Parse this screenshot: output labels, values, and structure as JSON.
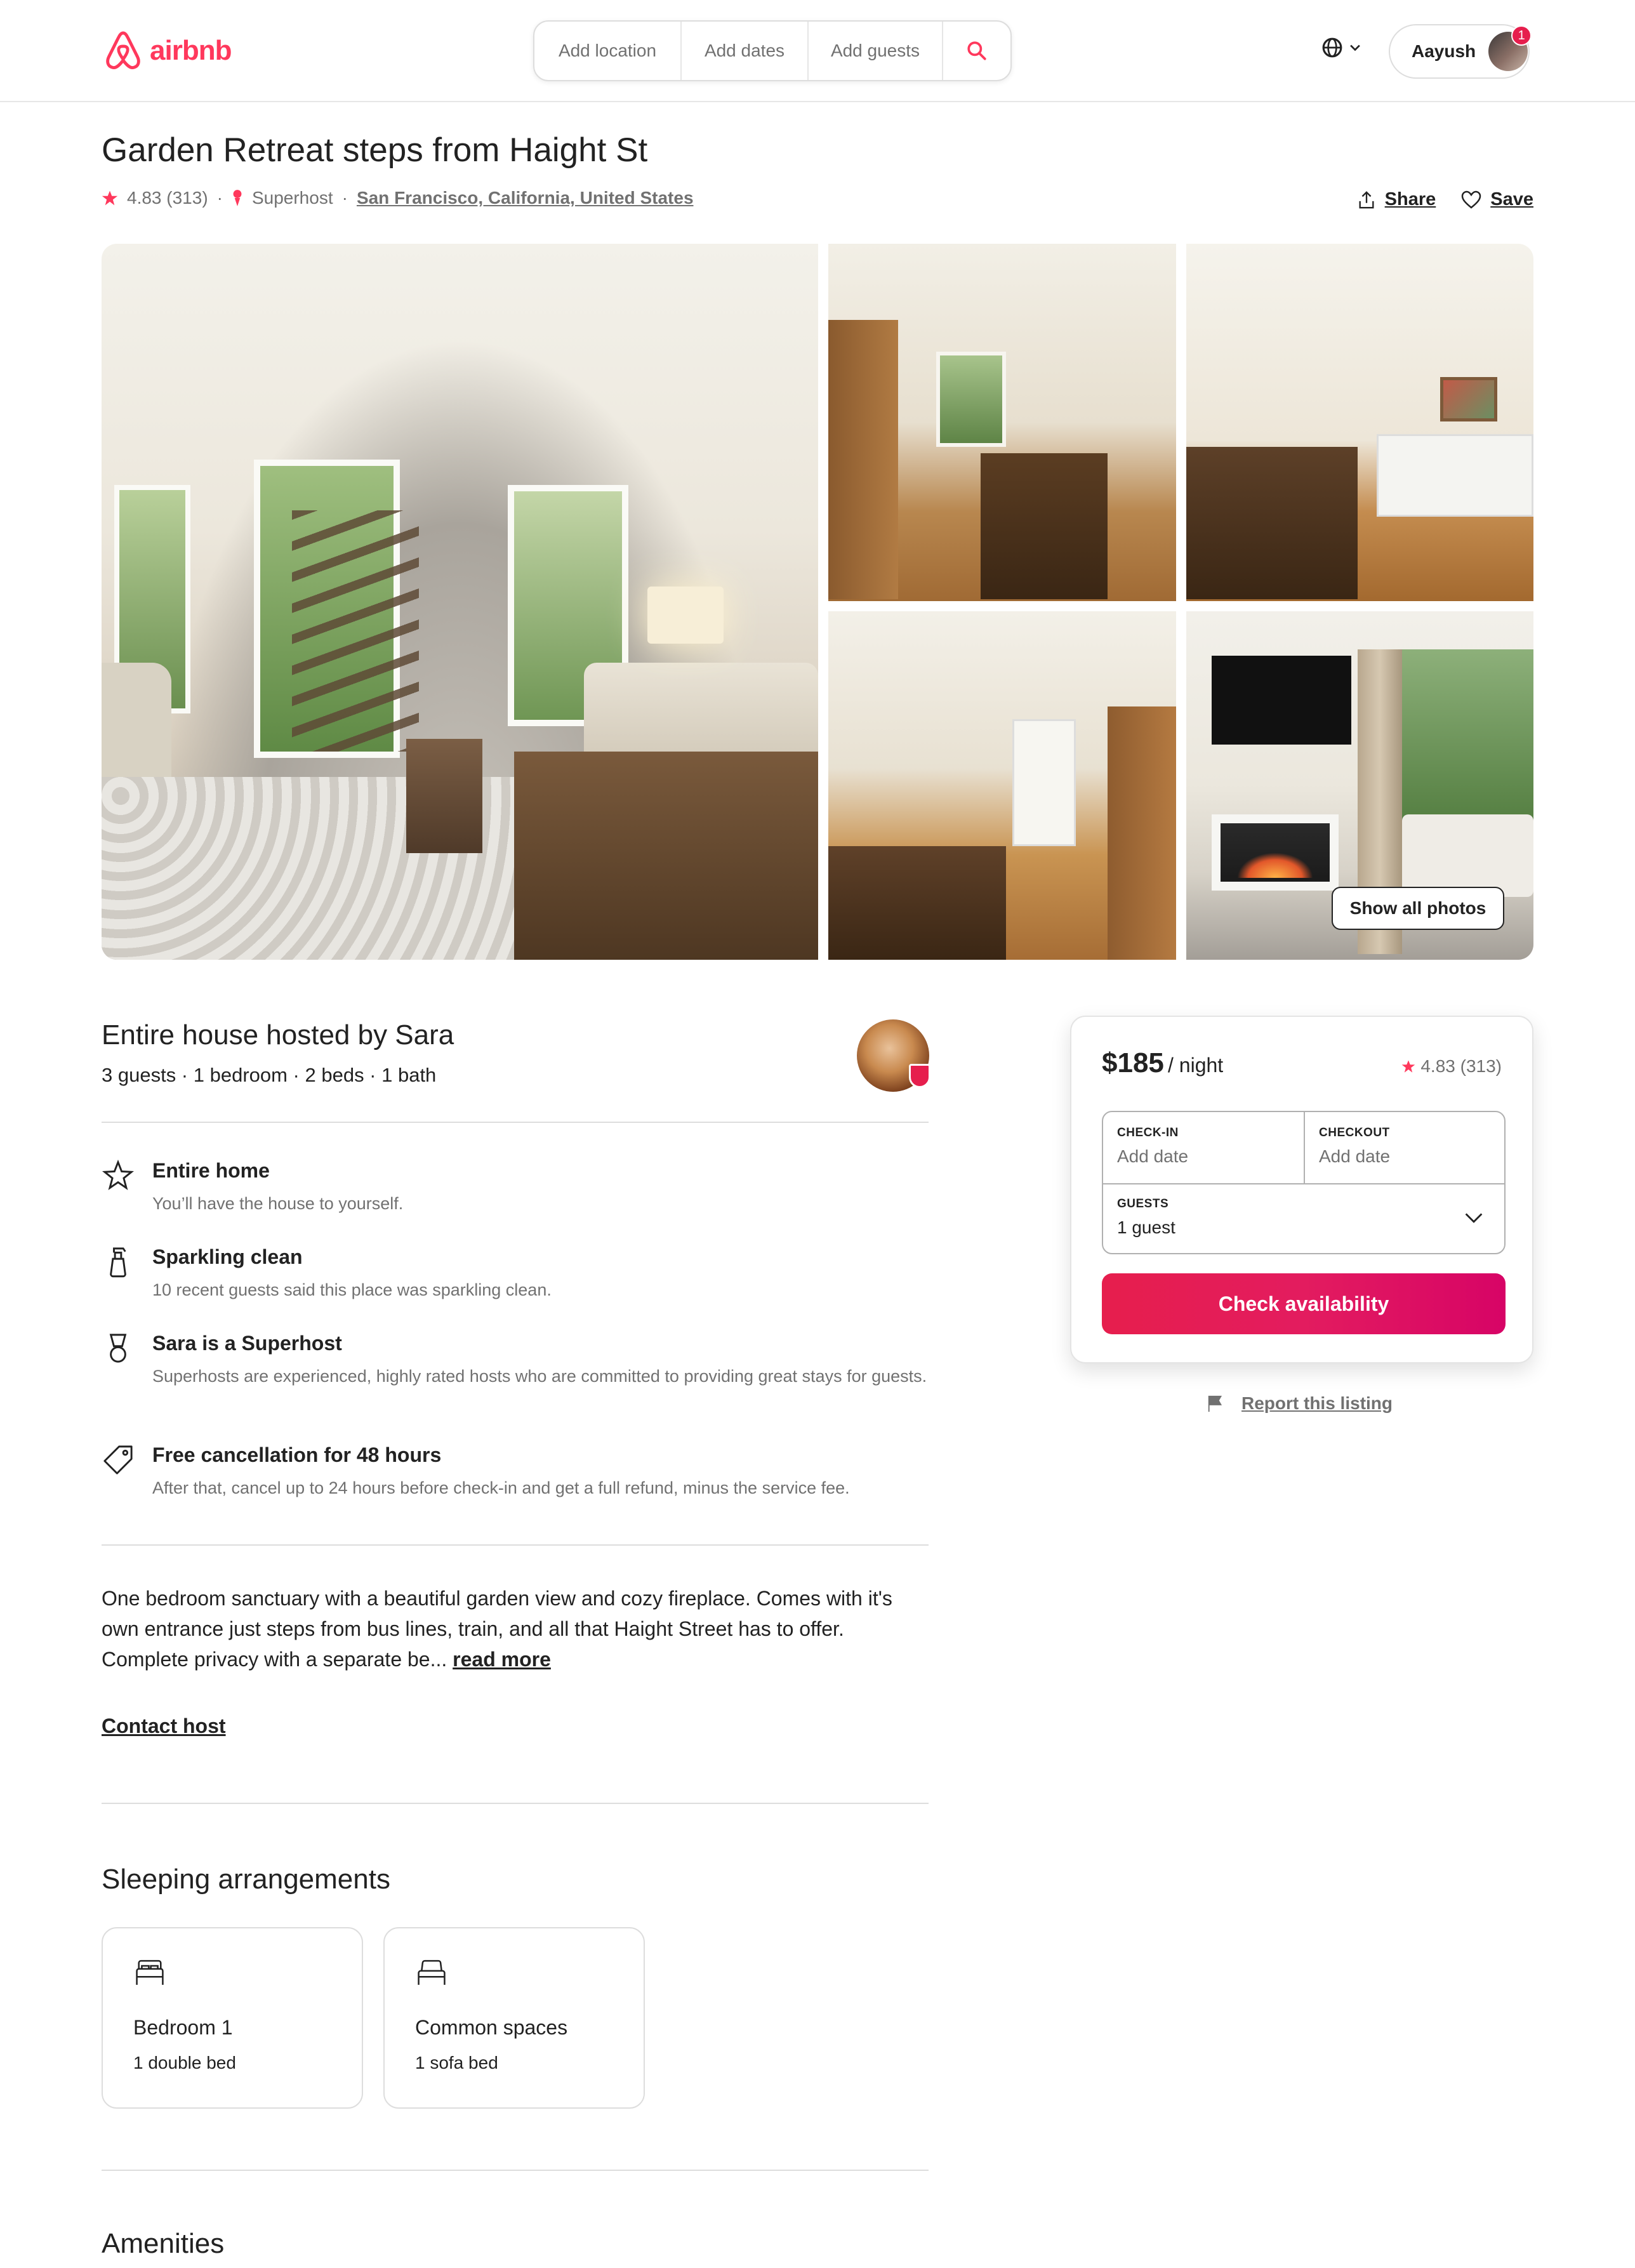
{
  "brand": {
    "name": "airbnb",
    "accent": "#ff385c"
  },
  "search": {
    "location": "Add location",
    "dates": "Add dates",
    "guests": "Add guests"
  },
  "user": {
    "name": "Aayush",
    "notifications": "1"
  },
  "listing": {
    "title": "Garden Retreat steps from Haight St",
    "rating": "4.83 (313)",
    "superhost": "Superhost",
    "location": "San Francisco, California, United States",
    "share_label": "Share",
    "save_label": "Save",
    "show_all_photos": "Show all photos"
  },
  "host": {
    "title": "Entire house hosted by Sara",
    "summary": "3 guests · 1 bedroom · 2 beds · 1 bath"
  },
  "features": [
    {
      "icon": "star-outline-icon",
      "title": "Entire home",
      "desc": "You’ll have the house to yourself."
    },
    {
      "icon": "spray-bottle-icon",
      "title": "Sparkling clean",
      "desc": "10 recent guests said this place was sparkling clean."
    },
    {
      "icon": "superhost-medal-icon",
      "title": "Sara is a Superhost",
      "desc": "Superhosts are experienced, highly rated hosts who are committed to providing great stays for guests."
    },
    {
      "icon": "tag-icon",
      "title": "Free cancellation for 48 hours",
      "desc": "After that, cancel up to 24 hours before check-in and get a full refund, minus the service fee."
    }
  ],
  "description": {
    "text": "One bedroom sanctuary with a beautiful garden view and cozy fireplace. Comes with it's own entrance just steps from bus lines, train, and all that Haight Street has to offer. Complete privacy with a separate be...",
    "read_more": "read more",
    "contact_host": "Contact host"
  },
  "sleeping": {
    "title": "Sleeping arrangements",
    "rooms": [
      {
        "name": "Bedroom 1",
        "beds": "1 double bed"
      },
      {
        "name": "Common spaces",
        "beds": "1 sofa bed"
      }
    ]
  },
  "amenities": {
    "title": "Amenities"
  },
  "booking": {
    "price": "$185",
    "per": "/ night",
    "rating": "4.83 (313)",
    "checkin_label": "CHECK-IN",
    "checkin_value": "Add date",
    "checkout_label": "CHECKOUT",
    "checkout_value": "Add date",
    "guests_label": "GUESTS",
    "guests_value": "1 guest",
    "button": "Check availability",
    "report": "Report this listing"
  }
}
